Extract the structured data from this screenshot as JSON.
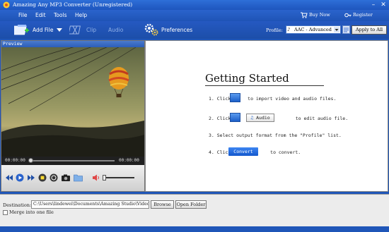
{
  "window": {
    "title": "Amazing Any MP3 Converter (Unregistered)",
    "minimize": "–",
    "close": "✕"
  },
  "menu": {
    "items": [
      "File",
      "Edit",
      "Tools",
      "Help"
    ],
    "buy_now": "Buy Now",
    "register": "Register"
  },
  "toolbar": {
    "add_file": "Add File",
    "clip": "Clip",
    "audio": "Audio",
    "preferences": "Preferences",
    "profile_label": "Profile",
    "profile_value": "AAC - Advanced",
    "apply_all": "Apply to All"
  },
  "preview": {
    "header": "Preview",
    "time_current": "00:00:00",
    "time_total": "00:00:00"
  },
  "getting_started": {
    "title": "Getting Started",
    "step1_prefix": "1. Click",
    "step1_suffix": "to import video and audio files.",
    "step2_prefix": "2. Click",
    "step2_and": "and",
    "step2_audio": "Audio",
    "step2_suffix": "to edit audio file.",
    "step3": "3. Select output format from the \"Profile\" list.",
    "step4_prefix": "4. Click",
    "step4_button": "Convert",
    "step4_suffix": "to convert."
  },
  "bottom": {
    "destination_label": "Destination:",
    "destination_value": "C:\\Users\\lindewei\\Documents\\Amazing Studio\\Video",
    "browse": "Browse",
    "open_folder": "Open Folder",
    "merge_label": "Merge into one file"
  },
  "colors": {
    "chrome_blue": "#1f56b8",
    "accent_button": "#1357cc"
  }
}
